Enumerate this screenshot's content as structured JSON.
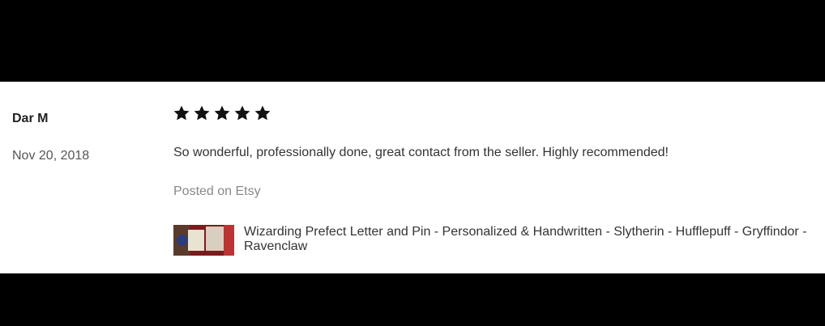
{
  "review": {
    "reviewer": "Dar M",
    "date": "Nov 20, 2018",
    "rating": 5,
    "text": "So wonderful, professionally done, great contact from the seller. Highly recommended!",
    "source": "Posted on Etsy",
    "product_title": "Wizarding Prefect Letter and Pin - Personalized & Handwritten - Slytherin - Hufflepuff - Gryffindor - Ravenclaw"
  },
  "icons": {
    "star": "star-icon",
    "thumbnail": "product-thumbnail"
  }
}
